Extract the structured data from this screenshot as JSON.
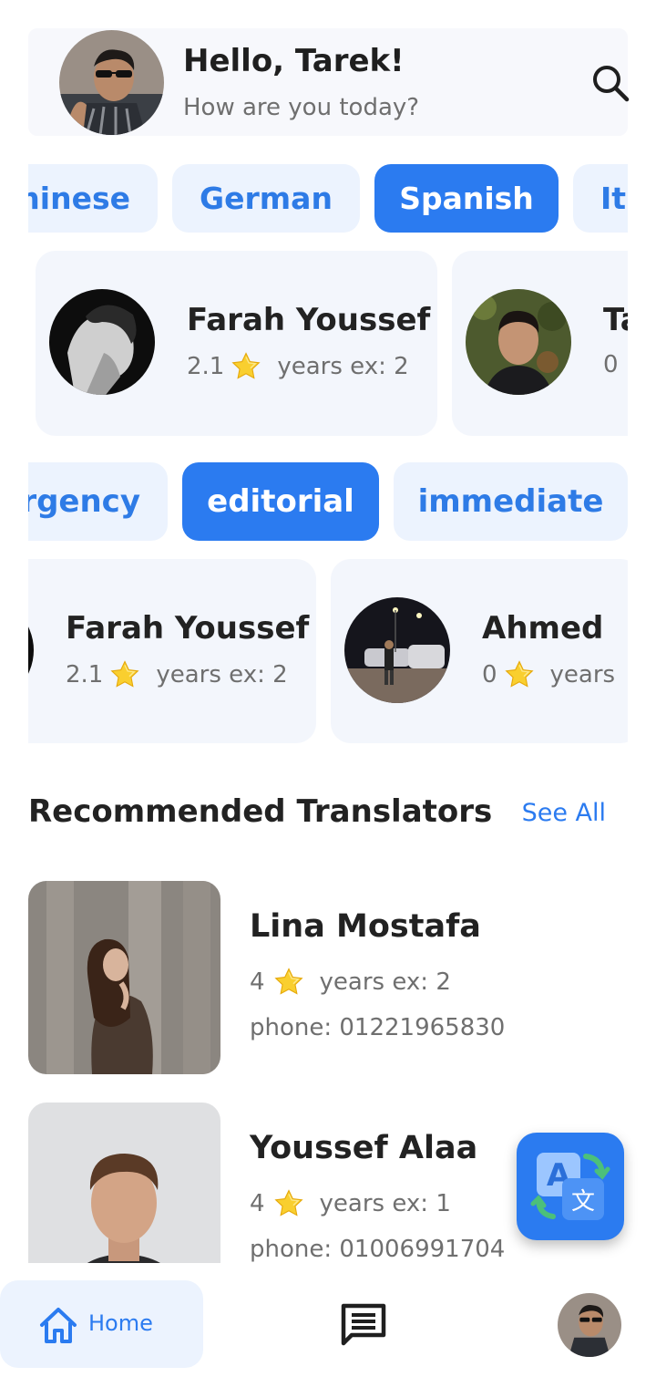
{
  "header": {
    "greeting": "Hello, Tarek!",
    "subtitle": "How are you today?",
    "search_icon": "search-icon"
  },
  "languages": [
    {
      "label": "hinese",
      "selected": false
    },
    {
      "label": "German",
      "selected": false
    },
    {
      "label": "Spanish",
      "selected": true
    },
    {
      "label": "It",
      "selected": false
    }
  ],
  "featured_translators": [
    {
      "name": "Farah Youssef",
      "rating": "2.1",
      "years_label": "years ex: 2"
    },
    {
      "name": "Ta",
      "rating": "0",
      "years_label": ""
    }
  ],
  "categories": [
    {
      "label": "rgency",
      "selected": false
    },
    {
      "label": "editorial",
      "selected": true
    },
    {
      "label": "immediate",
      "selected": false
    }
  ],
  "category_translators": [
    {
      "name": "Farah Youssef",
      "rating": "2.1",
      "years_label": "years ex: 2"
    },
    {
      "name": "Ahmed",
      "rating": "0",
      "years_label": "years"
    }
  ],
  "recommended": {
    "title": "Recommended Translators",
    "see_all": "See All",
    "items": [
      {
        "name": "Lina Mostafa",
        "rating": "4",
        "years_label": "years ex: 2",
        "phone": "phone: 01221965830"
      },
      {
        "name": "Youssef Alaa",
        "rating": "4",
        "years_label": "years ex: 1",
        "phone": "phone: 01006991704"
      }
    ]
  },
  "fab": {
    "icon": "translate-icon"
  },
  "bottom_nav": {
    "home_label": "Home",
    "home_icon": "home-icon",
    "chat_icon": "chat-icon",
    "profile_icon": "profile-avatar"
  },
  "colors": {
    "accent": "#2b7bf0",
    "chip_bg": "#ecf3fe",
    "card_bg": "#f3f6fc",
    "star": "#f7c61c"
  }
}
